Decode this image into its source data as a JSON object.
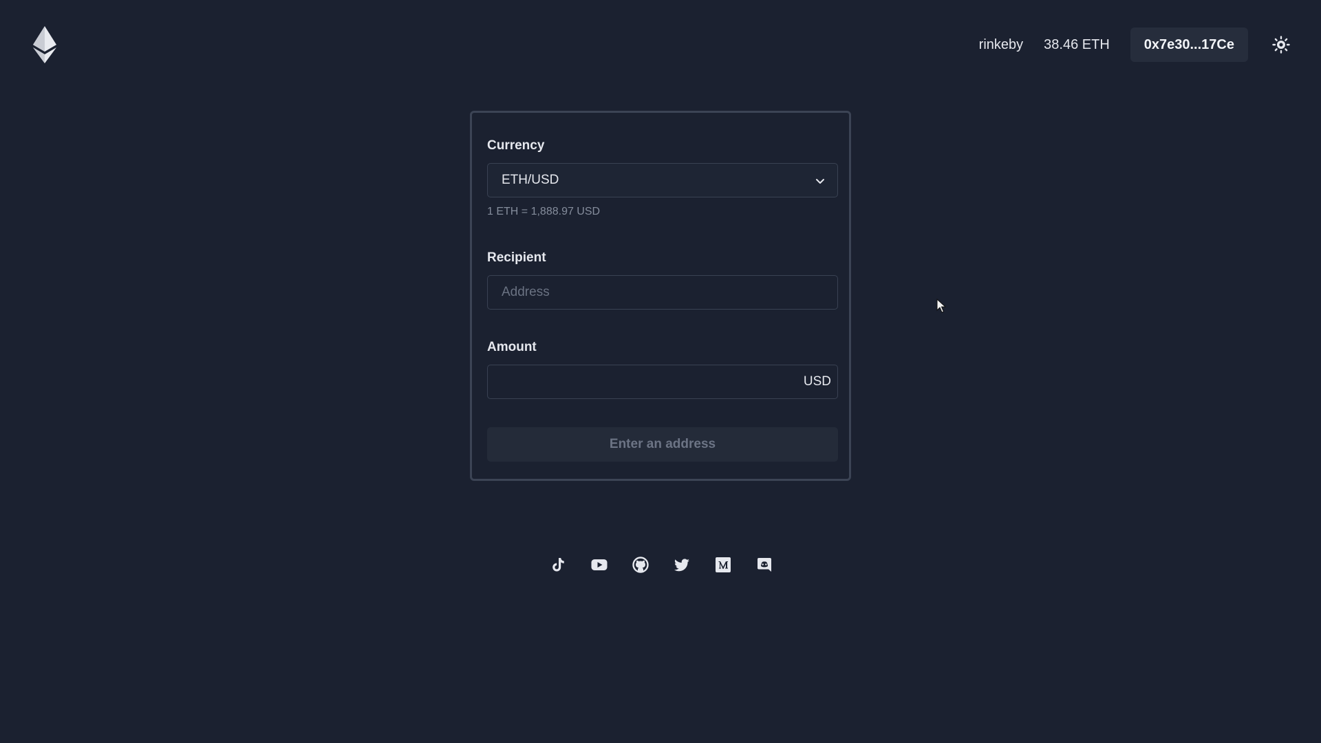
{
  "header": {
    "logo_icon": "ethereum-logo-icon",
    "network": "rinkeby",
    "balance": "38.46 ETH",
    "account": "0x7e30...17Ce",
    "theme_icon": "sun-icon"
  },
  "form": {
    "currency": {
      "label": "Currency",
      "selected": "ETH/USD",
      "rate": "1 ETH = 1,888.97 USD"
    },
    "recipient": {
      "label": "Recipient",
      "placeholder": "Address",
      "value": ""
    },
    "amount": {
      "label": "Amount",
      "value": "",
      "unit": "USD"
    },
    "submit_label": "Enter an address"
  },
  "social": [
    {
      "name": "tiktok-icon"
    },
    {
      "name": "youtube-icon"
    },
    {
      "name": "github-icon"
    },
    {
      "name": "twitter-icon"
    },
    {
      "name": "medium-icon"
    },
    {
      "name": "discord-icon"
    }
  ],
  "colors": {
    "background": "#1b2130",
    "card_border": "#3c4455",
    "text": "#e6e8ee",
    "muted": "#858d9c",
    "button_disabled_bg": "#242b39"
  }
}
